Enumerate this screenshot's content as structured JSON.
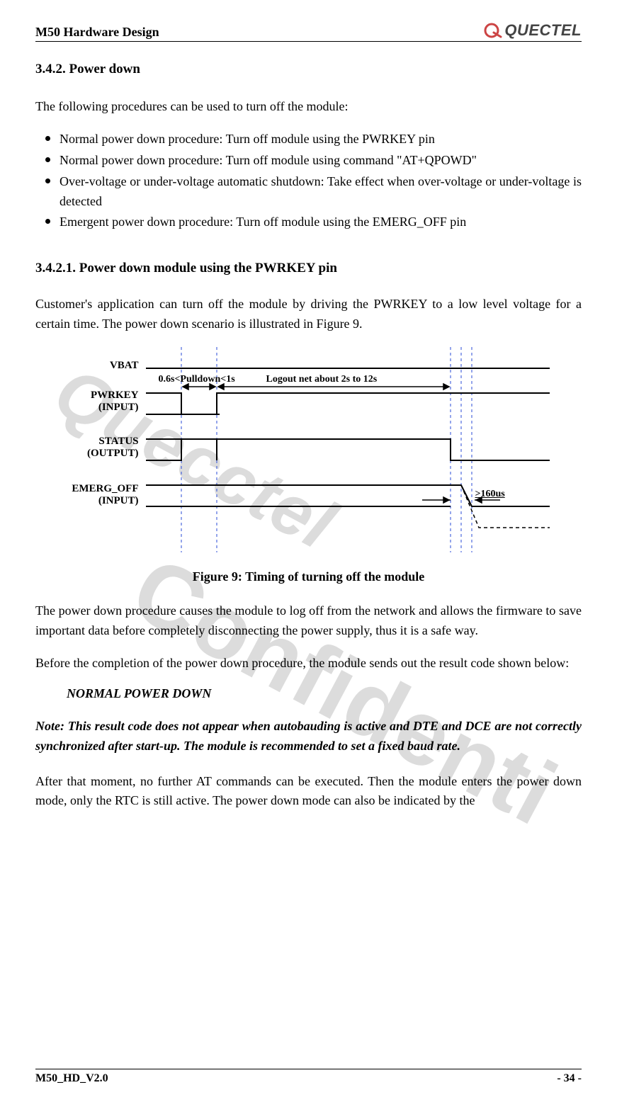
{
  "header": {
    "title": "M50 Hardware Design",
    "brand": "QUECTEL"
  },
  "watermarks": {
    "wm1": "Quecctel",
    "wm2": "Confidenti"
  },
  "section": {
    "num_title": "3.4.2. Power down",
    "intro": "The following procedures can be used to turn off the module:",
    "bullets": [
      "Normal power down procedure: Turn off module using the PWRKEY pin",
      "Normal power down procedure: Turn off module using command \"AT+QPOWD\"",
      "Over-voltage or under-voltage automatic shutdown: Take effect when over-voltage or under-voltage is detected",
      "Emergent power down procedure: Turn off module using the EMERG_OFF pin"
    ],
    "sub_title": "3.4.2.1. Power down module using the PWRKEY pin",
    "sub_para": "Customer's application can turn off the module by driving the PWRKEY to a low level voltage for a certain time. The power down scenario is illustrated in Figure 9."
  },
  "figure": {
    "labels": {
      "vbat": "VBAT",
      "pwrkey_1": "PWRKEY",
      "pwrkey_2": "(INPUT)",
      "status_1": "STATUS",
      "status_2": "(OUTPUT)",
      "emerg_1": "EMERG_OFF",
      "emerg_2": "(INPUT)"
    },
    "ann": {
      "pulldown": "0.6s<Pulldown<1s",
      "logout": "Logout net about 2s to 12s",
      "t160": ">160us"
    },
    "caption_prefix": "Figure 9:",
    "caption_text": " Timing of turning off the module"
  },
  "after": {
    "p1": "The power down procedure causes the module to log off from the network and allows the firmware to save important data before completely disconnecting the power supply, thus it is a safe way.",
    "p2": "Before the completion of the power down procedure, the module sends out the result code shown below:",
    "result_code": "NORMAL POWER DOWN",
    "note": "Note: This result code does not appear when autobauding is active and DTE and DCE are not correctly synchronized after start-up. The module is recommended to set a fixed baud rate.",
    "p3": "After that moment, no further AT commands can be executed. Then the module enters the power down mode, only the RTC is still active. The power down mode can also be indicated by the"
  },
  "footer": {
    "left": "M50_HD_V2.0",
    "right": "- 34 -"
  }
}
